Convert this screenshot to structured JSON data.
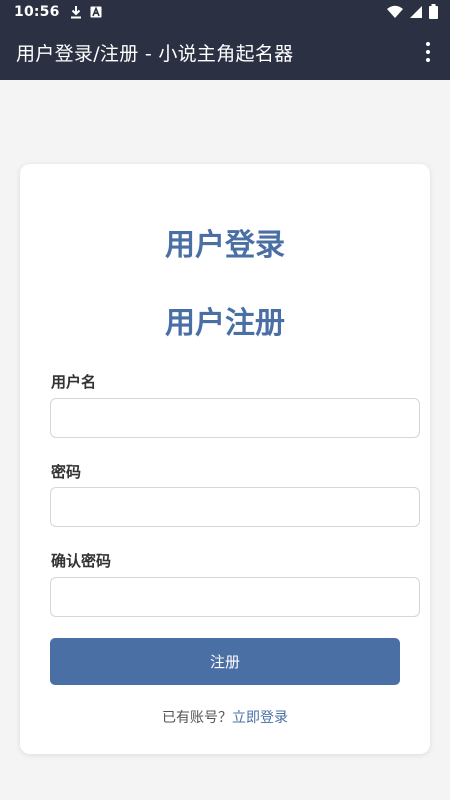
{
  "status_bar": {
    "time": "10:56",
    "icons_left": [
      "download-icon",
      "a-icon"
    ],
    "icons_right": [
      "wifi-icon",
      "signal-icon",
      "battery-icon"
    ]
  },
  "app_bar": {
    "title": "用户登录/注册 - 小说主角起名器",
    "menu_icon": "more-vert-icon"
  },
  "card": {
    "login_heading": "用户登录",
    "register_heading": "用户注册",
    "fields": {
      "username_label": "用户名",
      "username_value": "",
      "password_label": "密码",
      "password_value": "",
      "confirm_label": "确认密码",
      "confirm_value": ""
    },
    "submit_label": "注册",
    "footer_text": "已有账号？",
    "footer_link": "立即登录"
  },
  "colors": {
    "app_bar_bg": "#2b3042",
    "accent": "#4a6fa5",
    "background": "#f4f4f4",
    "card_bg": "#ffffff"
  }
}
